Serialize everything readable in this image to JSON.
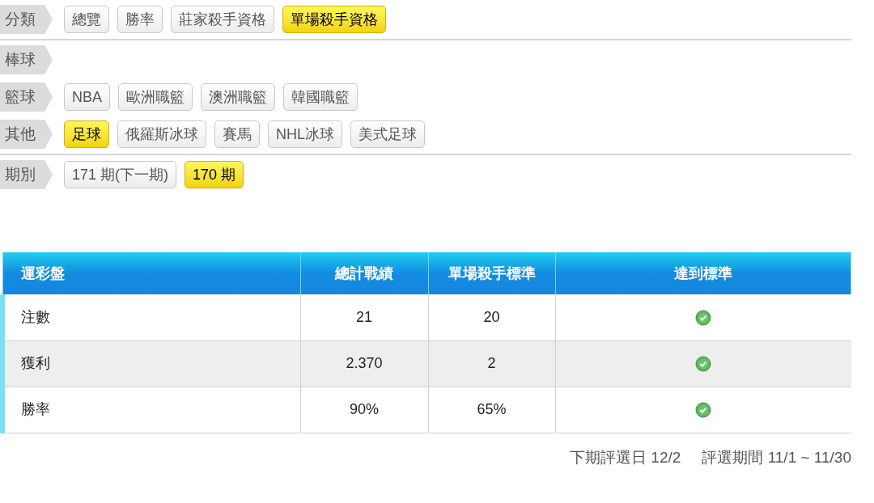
{
  "filter_sections": [
    {
      "rows": [
        {
          "label": "分類",
          "options": [
            {
              "label": "總覽",
              "selected": false
            },
            {
              "label": "勝率",
              "selected": false
            },
            {
              "label": "莊家殺手資格",
              "selected": false
            },
            {
              "label": "單場殺手資格",
              "selected": true
            }
          ]
        }
      ]
    },
    {
      "rows": [
        {
          "label": "棒球",
          "options": []
        },
        {
          "label": "籃球",
          "options": [
            {
              "label": "NBA",
              "selected": false
            },
            {
              "label": "歐洲職籃",
              "selected": false
            },
            {
              "label": "澳洲職籃",
              "selected": false
            },
            {
              "label": "韓國職籃",
              "selected": false
            }
          ]
        },
        {
          "label": "其他",
          "options": [
            {
              "label": "足球",
              "selected": true
            },
            {
              "label": "俄羅斯冰球",
              "selected": false
            },
            {
              "label": "賽馬",
              "selected": false
            },
            {
              "label": "NHL冰球",
              "selected": false
            },
            {
              "label": "美式足球",
              "selected": false
            }
          ]
        }
      ]
    },
    {
      "rows": [
        {
          "label": "期別",
          "options": [
            {
              "label": "171 期(下一期)",
              "selected": false
            },
            {
              "label": "170 期",
              "selected": true
            }
          ]
        }
      ]
    }
  ],
  "table": {
    "columns": [
      "運彩盤",
      "總計戰績",
      "單場殺手標準",
      "達到標準"
    ],
    "rows": [
      {
        "item": "注數",
        "total": "21",
        "standard": "20",
        "met": true
      },
      {
        "item": "獲利",
        "total": "2.370",
        "standard": "2",
        "met": true
      },
      {
        "item": "勝率",
        "total": "90%",
        "standard": "65%",
        "met": true
      }
    ]
  },
  "footer": {
    "next_date": "下期評選日 12/2",
    "period": "評選期間 11/1 ~ 11/30"
  }
}
